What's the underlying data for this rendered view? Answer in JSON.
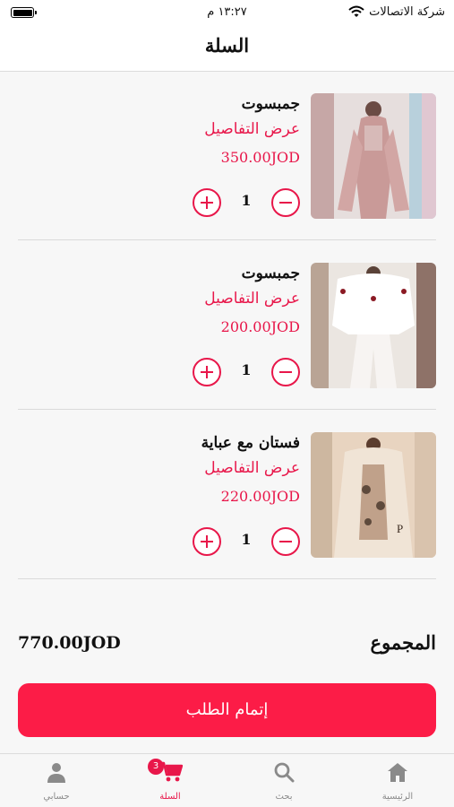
{
  "status_bar": {
    "carrier": "شركة الاتصالات",
    "time": "١٣:٢٧ م"
  },
  "header": {
    "title": "السلة"
  },
  "colors": {
    "accent": "#e8174a",
    "button": "#fc1c47"
  },
  "cart": {
    "details_label": "عرض التفاصيل",
    "items": [
      {
        "name": "جمبسوت",
        "price": "350.00JOD",
        "qty": "1"
      },
      {
        "name": "جمبسوت",
        "price": "200.00JOD",
        "qty": "1"
      },
      {
        "name": "فستان مع عباية",
        "price": "220.00JOD",
        "qty": "1"
      }
    ]
  },
  "summary": {
    "total_label": "المجموع",
    "total_value": "770.00JOD"
  },
  "checkout": {
    "label": "إتمام الطلب"
  },
  "tabbar": {
    "badge": "3",
    "tabs": [
      {
        "label": "حسابي",
        "icon": "person-icon"
      },
      {
        "label": "السلة",
        "icon": "cart-icon",
        "active": true
      },
      {
        "label": "بحث",
        "icon": "search-icon"
      },
      {
        "label": "الرئيسية",
        "icon": "home-icon"
      }
    ]
  }
}
